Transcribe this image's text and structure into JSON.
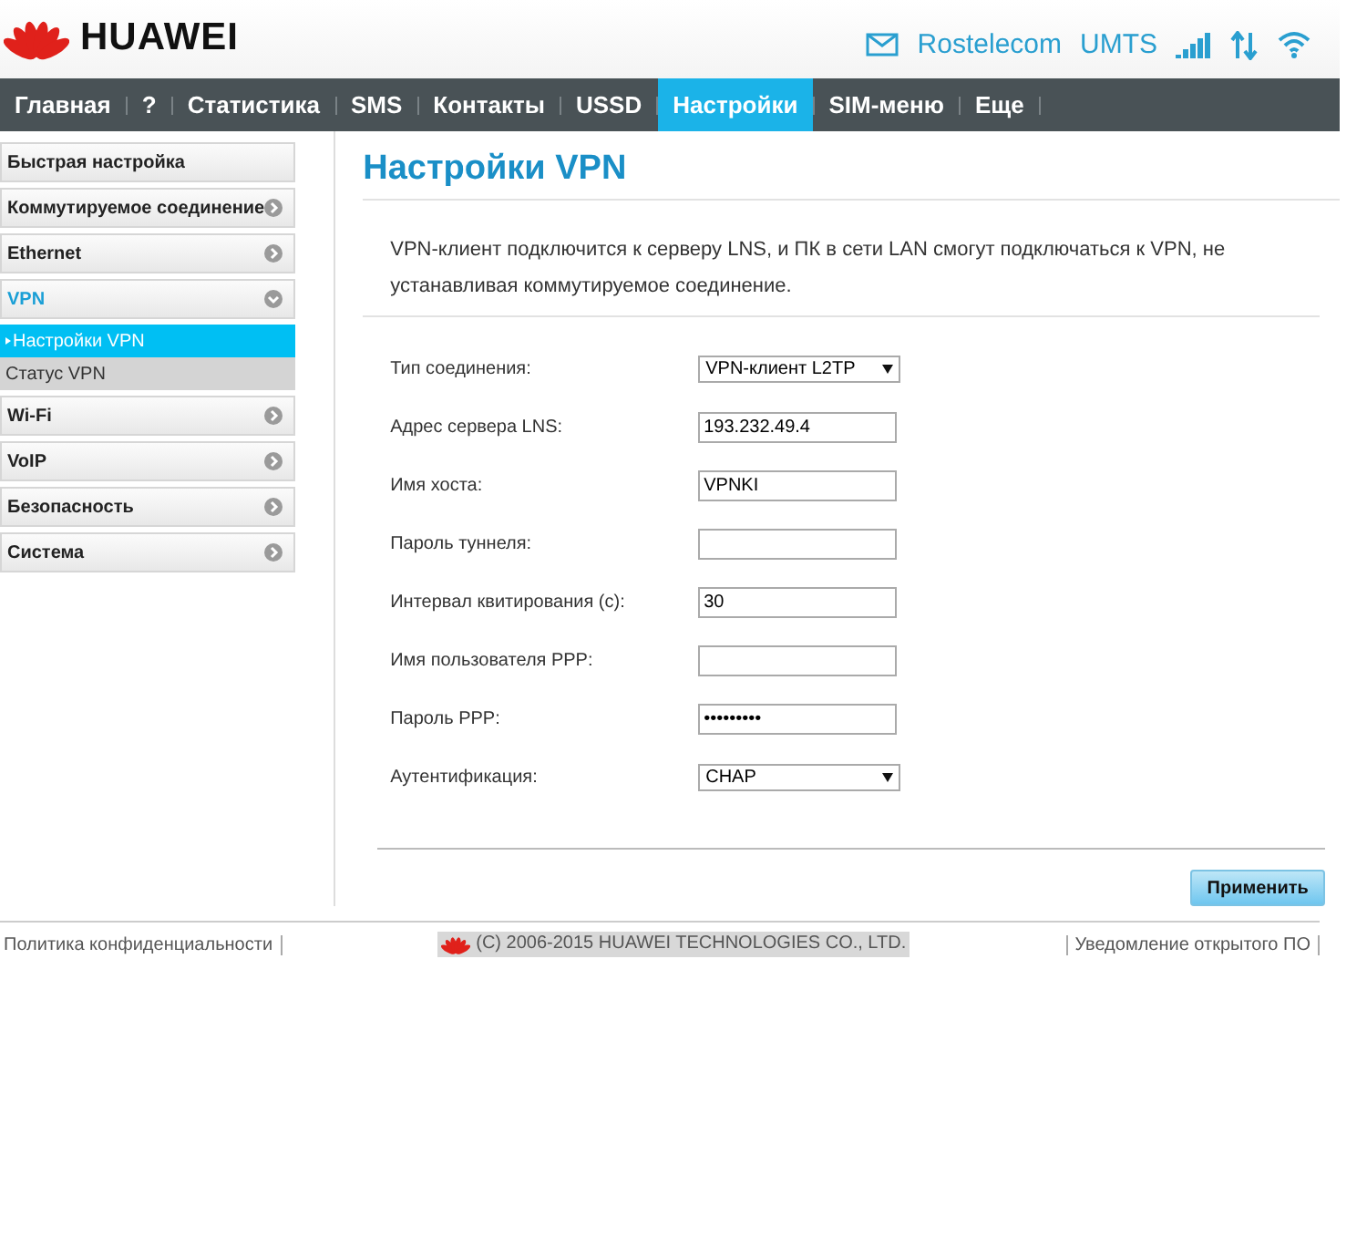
{
  "header": {
    "brand": "HUAWEI",
    "operator": "Rostelecom",
    "network": "UMTS"
  },
  "nav": [
    {
      "label": "Главная",
      "selected": false
    },
    {
      "label": "?",
      "selected": false
    },
    {
      "label": "Статистика",
      "selected": false
    },
    {
      "label": "SMS",
      "selected": false
    },
    {
      "label": "Контакты",
      "selected": false
    },
    {
      "label": "USSD",
      "selected": false
    },
    {
      "label": "Настройки",
      "selected": true
    },
    {
      "label": "SIM-меню",
      "selected": false
    },
    {
      "label": "Еще",
      "selected": false
    }
  ],
  "sidebar": {
    "items": [
      {
        "label": "Быстрая настройка",
        "selected": false
      },
      {
        "label": "Коммутируемое соединение",
        "expanded": false,
        "selected": false
      },
      {
        "label": "Ethernet",
        "expanded": false,
        "selected": false
      },
      {
        "label": "VPN",
        "expanded": true,
        "selected": true,
        "children": [
          {
            "label": "Настройки VPN",
            "selected": true
          },
          {
            "label": "Статус VPN",
            "selected": false
          }
        ]
      },
      {
        "label": "Wi-Fi",
        "expanded": false,
        "selected": false
      },
      {
        "label": "VoIP",
        "expanded": false,
        "selected": false
      },
      {
        "label": "Безопасность",
        "expanded": false,
        "selected": false
      },
      {
        "label": "Система",
        "expanded": false,
        "selected": false
      }
    ]
  },
  "content": {
    "title": "Настройки VPN",
    "description": "VPN-клиент подключится к серверу LNS, и ПК в сети LAN смогут подключаться к VPN, не устанавливая коммутируемое соединение.",
    "fields": [
      {
        "kind": "select",
        "label": "Тип соединения:",
        "value": "VPN-клиент L2TP"
      },
      {
        "kind": "text",
        "label": "Адрес сервера LNS:",
        "value": "193.232.49.4"
      },
      {
        "kind": "text",
        "label": "Имя хоста:",
        "value": "VPNKI"
      },
      {
        "kind": "text",
        "label": "Пароль туннеля:"
      },
      {
        "kind": "text",
        "label": "Интервал квитирования (с):",
        "value": "30"
      },
      {
        "kind": "text",
        "label": "Имя пользователя PPP:"
      },
      {
        "kind": "password",
        "label": "Пароль PPP:",
        "value": "•••••••••"
      },
      {
        "kind": "select",
        "label": "Аутентификация:",
        "value": "CHAP"
      }
    ],
    "apply_button": "Применить"
  },
  "footer": {
    "privacy": "Политика конфиденциальности",
    "copyright": "(C) 2006-2015 HUAWEI TECHNOLOGIES CO., LTD.",
    "notice": "Уведомление открытого ПО"
  }
}
